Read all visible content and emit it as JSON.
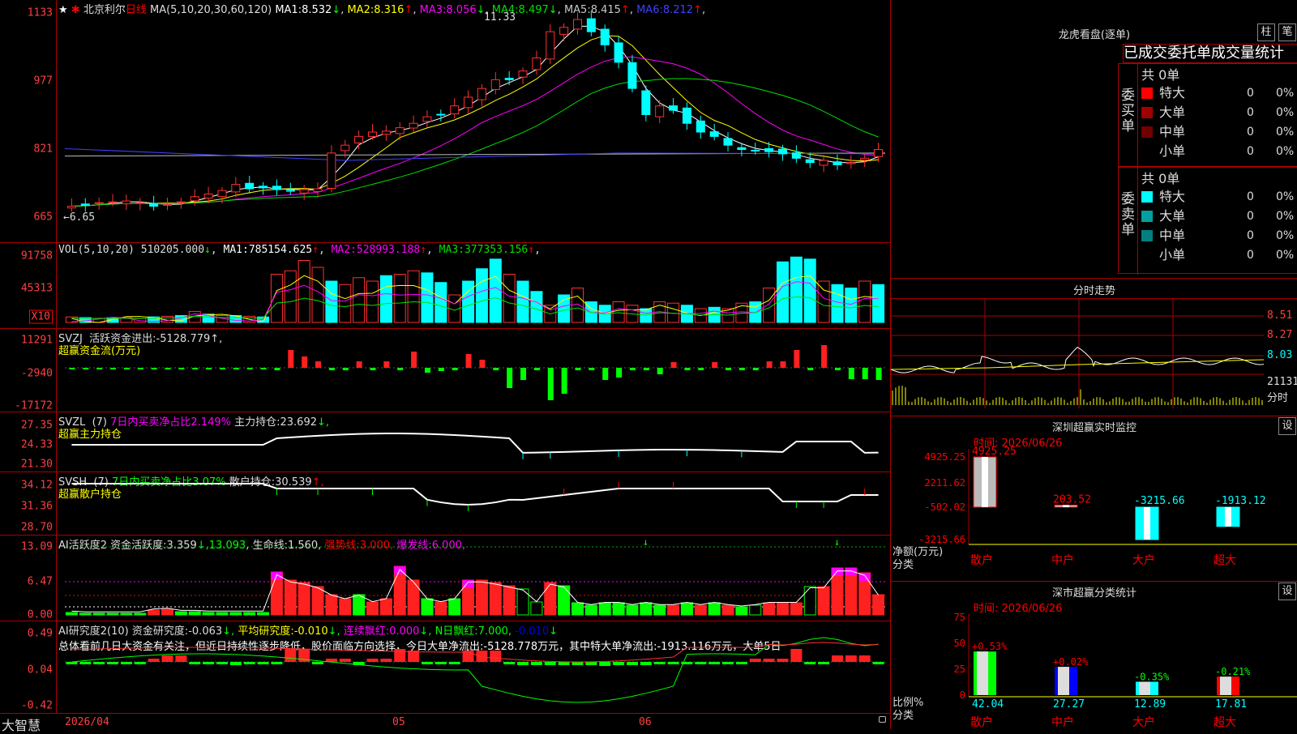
{
  "app": {
    "brand": "大智慧"
  },
  "kline": {
    "star": "★",
    "stock_name": "北京利尔",
    "period": "日线",
    "ma_params": "MA(5,10,20,30,60,120)",
    "ma": [
      {
        "label": "MA1:",
        "value": "8.532",
        "arrow": "↓",
        "color": "#ffffff"
      },
      {
        "label": "MA2:",
        "value": "8.316",
        "arrow": "↑",
        "color": "#ffff00"
      },
      {
        "label": "MA3:",
        "value": "8.056",
        "arrow": "↓",
        "color": "#ff00ff"
      },
      {
        "label": "MA4:",
        "value": "8.497",
        "arrow": "↓",
        "color": "#00e000"
      },
      {
        "label": "MA5:",
        "value": "8.415",
        "arrow": "↑",
        "color": "#c8c8c8"
      },
      {
        "label": "MA6:",
        "value": "8.212",
        "arrow": "↑",
        "color": "#4040ff"
      }
    ],
    "y_labels": [
      "1133",
      "977",
      "821",
      "665"
    ],
    "high_note": "11.33",
    "low_note": "←6.65"
  },
  "vol": {
    "params": "VOL(5,10,20)",
    "value": "510205.000",
    "arrow": "↓",
    "ma": [
      {
        "label": "MA1:",
        "value": "785154.625",
        "arrow": "↑",
        "color": "#ffffff"
      },
      {
        "label": "MA2:",
        "value": "528993.188",
        "arrow": "↑",
        "color": "#ff00ff"
      },
      {
        "label": "MA3:",
        "value": "377353.156",
        "arrow": "↑",
        "color": "#00e000"
      }
    ],
    "y_labels": [
      "91758",
      "45313"
    ],
    "unit": "X10"
  },
  "svzj": {
    "name": "SVZJ",
    "label": "活跃资金进出:",
    "value": "-5128.779",
    "suffix": "↑,",
    "sub": "超赢资金流(万元)",
    "y_labels": [
      "11291",
      "-2940",
      "-17172"
    ]
  },
  "svzl": {
    "name": "SVZL",
    "param": "(7)",
    "desc": "7日内买卖净占比2.149%",
    "label": "主力持仓:",
    "value": "23.692",
    "suffix": "↓,",
    "sub": "超赢主力持仓",
    "y_labels": [
      "27.35",
      "24.33",
      "21.30"
    ]
  },
  "svsh": {
    "name": "SVSH",
    "param": "(7)",
    "desc": "7日内买卖净占比3.07%",
    "label": "散户持仓:",
    "value": "30.539",
    "suffix": "↑,",
    "sub": "超赢散户持仓",
    "y_labels": [
      "34.12",
      "31.36",
      "28.70"
    ]
  },
  "ai_active": {
    "name": "AI活跃度2",
    "label": "资金活跃度:",
    "v1": "3.359",
    "a1": "↓,",
    "v2": "13.093",
    "v2_suffix": ",",
    "life_label": "生命线:",
    "life": "1.560",
    "life_suffix": ",",
    "strong_label": "强势线:",
    "strong": "3.000",
    "strong_suffix": ",",
    "burst_label": "爆发线:",
    "burst": "6.000",
    "burst_suffix": ",",
    "y_labels": [
      "13.09",
      "6.47",
      "0.00"
    ]
  },
  "ai_research": {
    "name": "AI研究度2(10)",
    "label1": "资金研究度:",
    "v1": "-0.063",
    "a1": "↓,",
    "label2": "平均研究度:",
    "v2": "-0.010",
    "a2": "↓,",
    "label3": "连续飘红:",
    "v3": "0.000",
    "a3": "↓,",
    "label4": "N日飘红:",
    "v4": "7.000",
    "v4_suffix": ",",
    "v5": "-0.010",
    "a5": "↓",
    "summary": "总体看前几日大资金有关注，但近日持续性逐步降低，股价面临方向选择，今日大单净流出:-5128.778万元，其中特大单净流出:-1913.116万元，大单5日",
    "y_labels": [
      "0.49",
      "0.04",
      "-0.42"
    ]
  },
  "x_axis": {
    "labels": [
      "2026/04",
      "05",
      "06"
    ]
  },
  "longhu": {
    "title": "龙虎看盘(逐单)",
    "btn1": "柱",
    "btn2": "笔",
    "header": "已成交委托单成交量统计",
    "buy": {
      "side": "委买单",
      "total_label": "共",
      "total": "0单",
      "rows": [
        {
          "label": "特大",
          "value": "0",
          "pct": "0%",
          "color": "#ff0000"
        },
        {
          "label": "大单",
          "value": "0",
          "pct": "0%",
          "color": "#a00000"
        },
        {
          "label": "中单",
          "value": "0",
          "pct": "0%",
          "color": "#700000"
        },
        {
          "label": "小单",
          "value": "0",
          "pct": "0%",
          "color": "#000000"
        }
      ]
    },
    "sell": {
      "side": "委卖单",
      "total_label": "共",
      "total": "0单",
      "rows": [
        {
          "label": "特大",
          "value": "0",
          "pct": "0%",
          "color": "#00ffff"
        },
        {
          "label": "大单",
          "value": "0",
          "pct": "0%",
          "color": "#00a0a0"
        },
        {
          "label": "中单",
          "value": "0",
          "pct": "0%",
          "color": "#008080"
        },
        {
          "label": "小单",
          "value": "0",
          "pct": "0%",
          "color": "#000000"
        }
      ]
    }
  },
  "intraday": {
    "title": "分时走势",
    "y_labels": [
      "8.51",
      "8.27",
      "8.03"
    ],
    "vol_label": "21131",
    "vol_unit": "分时"
  },
  "sz_monitor": {
    "title": "深圳超赢实时监控",
    "set_btn": "设",
    "time": "时间: 2026/06/26",
    "y_labels": [
      "4925.25",
      "2211.62",
      "-502.02",
      "-3215.66"
    ],
    "axis_name": "净额(万元)",
    "axis_cat": "分类",
    "categories": [
      "散户",
      "中户",
      "大户",
      "超大"
    ],
    "values": [
      4925.25,
      203.52,
      -3215.66,
      -1913.12
    ],
    "value_labels": [
      "4925.25",
      "203.52",
      "-3215.66",
      "-1913.12"
    ]
  },
  "sz_class": {
    "title": "深市超赢分类统计",
    "set_btn": "设",
    "time": "时间: 2026/06/26",
    "y_labels": [
      "75",
      "50",
      "25",
      "0"
    ],
    "axis_name": "比例%",
    "axis_cat": "分类",
    "categories": [
      "散户",
      "中户",
      "大户",
      "超大"
    ],
    "values": [
      42.04,
      27.27,
      12.89,
      17.81
    ],
    "value_labels": [
      "42.04",
      "27.27",
      "12.89",
      "17.81"
    ],
    "changes": [
      "+0.53%",
      "+0.02%",
      "-0.35%",
      "-0.21%"
    ]
  }
}
